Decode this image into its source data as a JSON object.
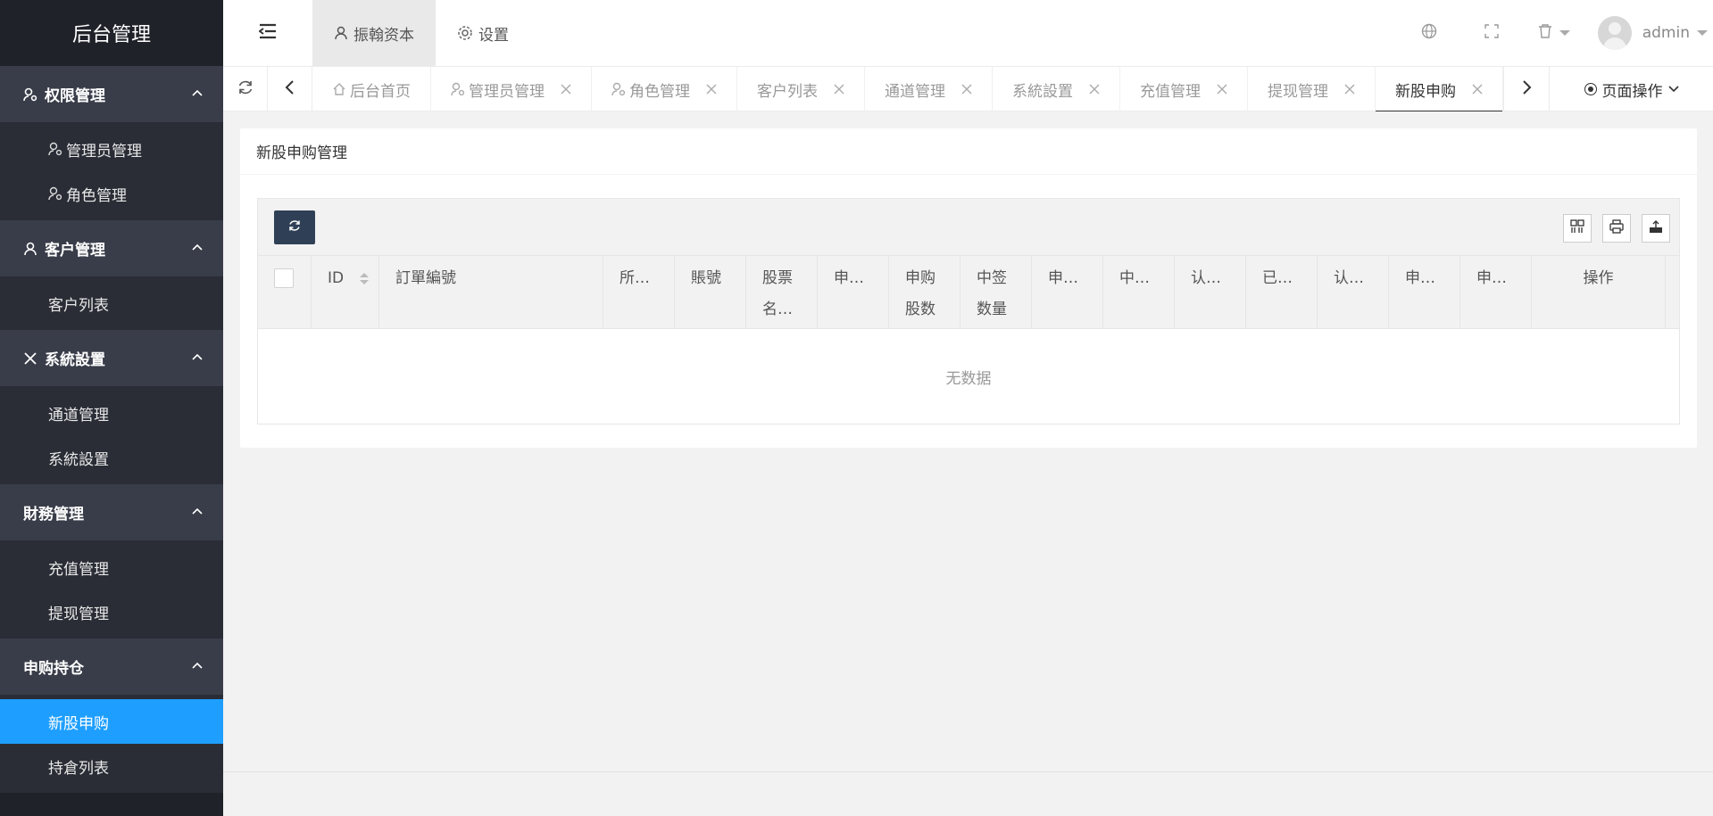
{
  "app": {
    "logo_title": "后台管理"
  },
  "sidebar": {
    "groups": [
      {
        "title": "权限管理",
        "icon": "user-gear-icon",
        "items": [
          {
            "label": "管理员管理",
            "icon": "user-gear-icon"
          },
          {
            "label": "角色管理",
            "icon": "user-gear-icon"
          }
        ]
      },
      {
        "title": "客户管理",
        "icon": "user-icon",
        "items": [
          {
            "label": "客户列表"
          }
        ]
      },
      {
        "title": "系統設置",
        "icon": "tools-icon",
        "items": [
          {
            "label": "通道管理"
          },
          {
            "label": "系統設置"
          }
        ]
      },
      {
        "title": "財務管理",
        "items": [
          {
            "label": "充值管理"
          },
          {
            "label": "提现管理"
          }
        ]
      },
      {
        "title": "申购持仓",
        "items": [
          {
            "label": "新股申购",
            "active": true
          },
          {
            "label": "持倉列表"
          }
        ]
      }
    ]
  },
  "header": {
    "top_tabs": [
      {
        "label": "振翰资本",
        "icon": "user-icon",
        "active": true
      },
      {
        "label": "设置",
        "icon": "gear-icon"
      }
    ],
    "user_name": "admin"
  },
  "tabbar": {
    "tabs": [
      {
        "label": "后台首页",
        "icon": "home-icon",
        "closable": false
      },
      {
        "label": "管理员管理",
        "icon": "user-gear-icon",
        "closable": true
      },
      {
        "label": "角色管理",
        "icon": "user-gear-icon",
        "closable": true
      },
      {
        "label": "客户列表",
        "closable": true
      },
      {
        "label": "通道管理",
        "closable": true
      },
      {
        "label": "系統設置",
        "closable": true
      },
      {
        "label": "充值管理",
        "closable": true
      },
      {
        "label": "提现管理",
        "closable": true
      },
      {
        "label": "新股申购",
        "closable": true,
        "active": true
      }
    ],
    "page_ops_label": "页面操作"
  },
  "card": {
    "title": "新股申购管理",
    "table": {
      "columns": [
        {
          "label": "ID",
          "sortable": true
        },
        {
          "label": "訂單編號"
        },
        {
          "label": "所…"
        },
        {
          "label": "賬號"
        },
        {
          "label": "股票\n名…"
        },
        {
          "label": "申…"
        },
        {
          "label": "申购\n股数"
        },
        {
          "label": "中签\n数量"
        },
        {
          "label": "申…"
        },
        {
          "label": "中…"
        },
        {
          "label": "认…"
        },
        {
          "label": "已…"
        },
        {
          "label": "认…"
        },
        {
          "label": "申…"
        },
        {
          "label": "申…"
        },
        {
          "label": "操作"
        }
      ],
      "empty_text": "无数据"
    }
  },
  "colors": {
    "sidebar_bg": "#20222a",
    "active": "#1e9fff",
    "refresh_btn": "#2f4056"
  }
}
